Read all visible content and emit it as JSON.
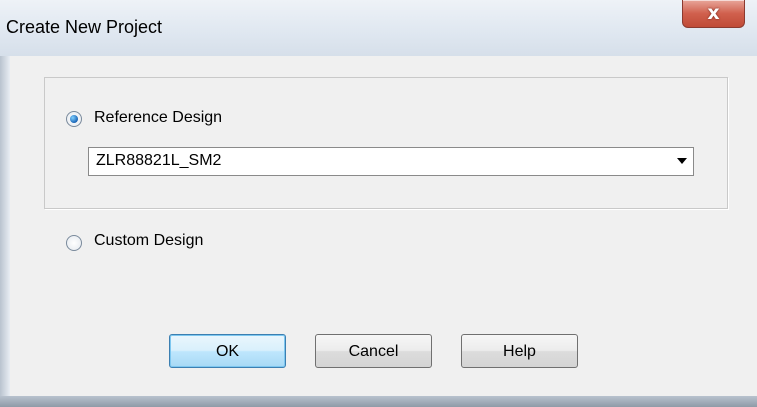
{
  "window": {
    "title": "Create New Project",
    "close_glyph": "x"
  },
  "reference": {
    "label": "Reference Design",
    "selected": true
  },
  "design_select": {
    "value": "ZLR88821L_SM2"
  },
  "custom": {
    "label": "Custom Design",
    "selected": false
  },
  "buttons": {
    "ok": "OK",
    "cancel": "Cancel",
    "help": "Help"
  },
  "colors": {
    "watermark": "#ff0000"
  }
}
